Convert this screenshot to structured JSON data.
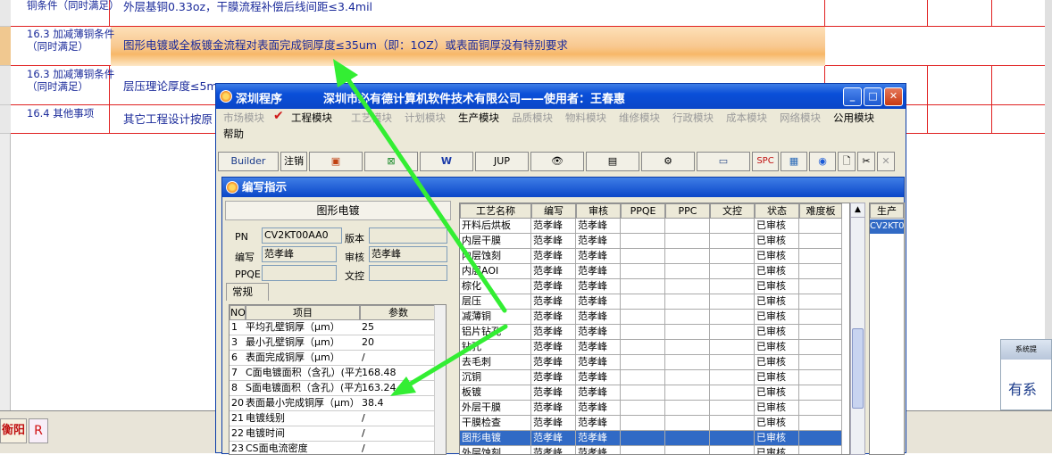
{
  "background": {
    "rows": [
      {
        "label": "铜条件（同时满足）",
        "content": "外层基铜0.33oz，干膜流程补偿后线间距≤3.4mil"
      },
      {
        "label": "16.3 加减薄铜条件（同时满足）",
        "content": "图形电镀或全板镀金流程对表面完成铜厚度≤35um（即：1OZ）或表面铜厚没有特别要求"
      },
      {
        "label": "16.3 加减薄铜条件（同时满足）",
        "content": "层压理论厚度≤5m"
      },
      {
        "label": "16.4 其他事项",
        "content": "其它工程设计按原"
      }
    ],
    "bottom_tab_1": "衡阳",
    "bottom_tab_2": "R",
    "notify_title": "系统提",
    "notify_text": "有系"
  },
  "main_window": {
    "app_name": "深圳程序",
    "company": "深圳市必有德计算机软件技术有限公司——使用者：王春惠",
    "menu": [
      {
        "label": "市场模块",
        "active": false
      },
      {
        "label": "工程模块",
        "active": true
      },
      {
        "label": "工艺模块",
        "active": false
      },
      {
        "label": "计划模块",
        "active": false
      },
      {
        "label": "生产模块",
        "active": true
      },
      {
        "label": "品质模块",
        "active": false
      },
      {
        "label": "物料模块",
        "active": false
      },
      {
        "label": "维修模块",
        "active": false
      },
      {
        "label": "行政模块",
        "active": false
      },
      {
        "label": "成本模块",
        "active": false
      },
      {
        "label": "网络模块",
        "active": false
      },
      {
        "label": "公用模块",
        "active": true
      }
    ],
    "menu_help": "帮助",
    "toolbar": {
      "builder": "Builder",
      "logout": "注销",
      "jup": "JUP",
      "spc": "SPC"
    }
  },
  "child_window": {
    "title": "编写指示",
    "form_heading": "图形电镀",
    "fields": {
      "pn_label": "PN",
      "pn_value": "CV2KT00AA0",
      "version_label": "版本",
      "version_value": "",
      "author_label": "编写",
      "author_value": "范孝峰",
      "reviewer_label": "审核",
      "reviewer_value": "范孝峰",
      "ppqe_label": "PPQE",
      "ppqe_value": "",
      "doccontrol_label": "文控",
      "doccontrol_value": ""
    },
    "tab_label": "常规",
    "param_table": {
      "headers": [
        "NO",
        "项目",
        "参数"
      ],
      "rows": [
        {
          "no": "1",
          "item": "平均孔壁铜厚（μm）",
          "value": "25"
        },
        {
          "no": "3",
          "item": "最小孔壁铜厚（μm）",
          "value": "20"
        },
        {
          "no": "6",
          "item": "表面完成铜厚（μm）",
          "value": "/"
        },
        {
          "no": "7",
          "item": "C面电镀面积（含孔）(平方",
          "value": "168.48"
        },
        {
          "no": "8",
          "item": "S面电镀面积（含孔）(平方",
          "value": "163.24"
        },
        {
          "no": "20",
          "item": "表面最小完成铜厚（μm）",
          "value": "38.4"
        },
        {
          "no": "21",
          "item": "电镀线别",
          "value": "/"
        },
        {
          "no": "22",
          "item": "电镀时间",
          "value": "/"
        },
        {
          "no": "23",
          "item": "CS面电流密度",
          "value": "/"
        }
      ]
    },
    "process_table": {
      "headers": [
        "工艺名称",
        "编写",
        "审核",
        "PPQE",
        "PPC",
        "文控",
        "状态",
        "难度板"
      ],
      "rows": [
        {
          "name": "开料后烘板",
          "author": "范孝峰",
          "reviewer": "范孝峰",
          "status": "已审核"
        },
        {
          "name": "内层干膜",
          "author": "范孝峰",
          "reviewer": "范孝峰",
          "status": "已审核"
        },
        {
          "name": "内层蚀刻",
          "author": "范孝峰",
          "reviewer": "范孝峰",
          "status": "已审核"
        },
        {
          "name": "内层AOI",
          "author": "范孝峰",
          "reviewer": "范孝峰",
          "status": "已审核"
        },
        {
          "name": "棕化",
          "author": "范孝峰",
          "reviewer": "范孝峰",
          "status": "已审核"
        },
        {
          "name": "层压",
          "author": "范孝峰",
          "reviewer": "范孝峰",
          "status": "已审核"
        },
        {
          "name": "减薄铜",
          "author": "范孝峰",
          "reviewer": "范孝峰",
          "status": "已审核"
        },
        {
          "name": "铝片钻孔",
          "author": "范孝峰",
          "reviewer": "范孝峰",
          "status": "已审核"
        },
        {
          "name": "钻孔",
          "author": "范孝峰",
          "reviewer": "范孝峰",
          "status": "已审核"
        },
        {
          "name": "去毛刺",
          "author": "范孝峰",
          "reviewer": "范孝峰",
          "status": "已审核"
        },
        {
          "name": "沉铜",
          "author": "范孝峰",
          "reviewer": "范孝峰",
          "status": "已审核"
        },
        {
          "name": "板镀",
          "author": "范孝峰",
          "reviewer": "范孝峰",
          "status": "已审核"
        },
        {
          "name": "外层干膜",
          "author": "范孝峰",
          "reviewer": "范孝峰",
          "status": "已审核"
        },
        {
          "name": "干膜检查",
          "author": "范孝峰",
          "reviewer": "范孝峰",
          "status": "已审核"
        },
        {
          "name": "图形电镀",
          "author": "范孝峰",
          "reviewer": "范孝峰",
          "status": "已审核",
          "selected": true
        },
        {
          "name": "外层蚀刻",
          "author": "范孝峰",
          "reviewer": "范孝峰",
          "status": "已审核"
        }
      ]
    },
    "side_table": {
      "header": "生产",
      "value": "CV2KT0"
    }
  },
  "colors": {
    "annotation_arrow": "#33ee33",
    "selection": "#316ac5",
    "title_bar": "#0a46c8",
    "highlight_row": "#f8c890"
  }
}
